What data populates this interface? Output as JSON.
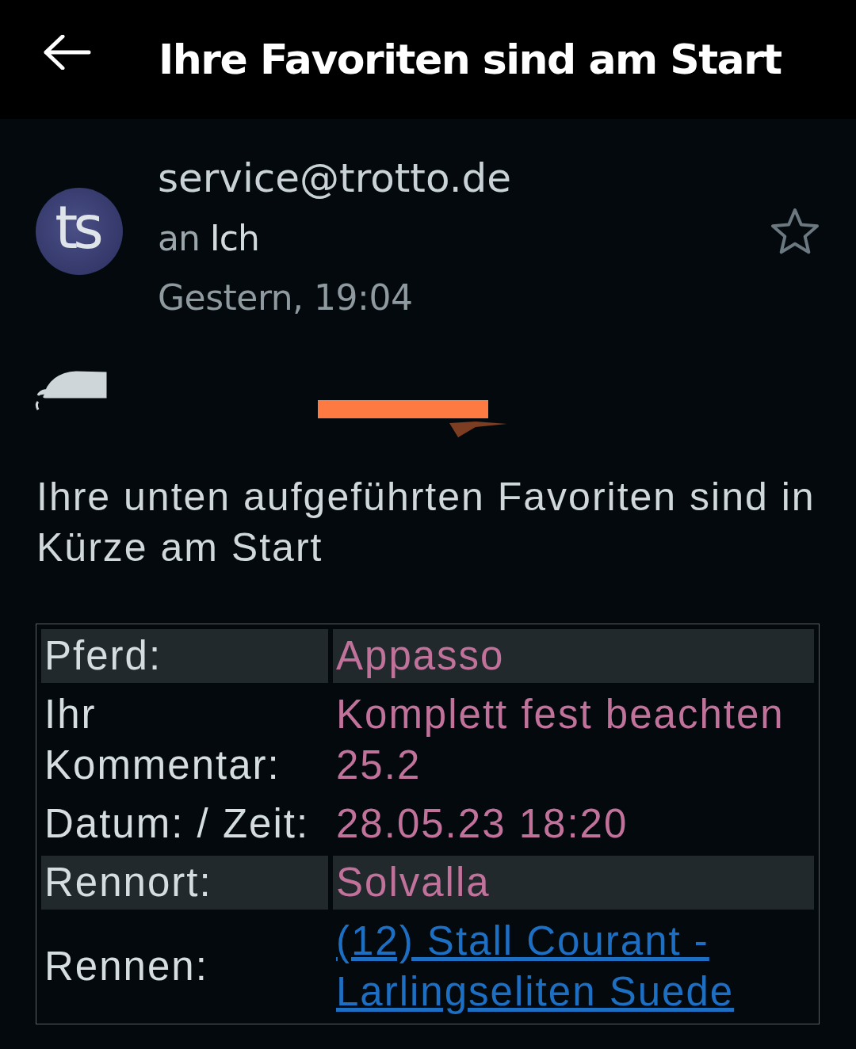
{
  "header": {
    "title": "Ihre Favoriten sind am Start"
  },
  "message": {
    "avatar": {
      "initials": "ts"
    },
    "sender": "service@trotto.de",
    "recipient_prefix": "an",
    "recipient": "Ich",
    "date": "Gestern, 19:04",
    "starred": false
  },
  "body_text": "Ihre unten aufgeführten Favoriten sind in Kürze am Start",
  "table": {
    "rows": [
      {
        "label": "Pferd:",
        "value": "Appasso",
        "kind": "text",
        "shaded": true
      },
      {
        "label": "Ihr Kommentar:",
        "value": "Komplett fest beachten 25.2",
        "kind": "text",
        "shaded": false
      },
      {
        "label": "Datum: / Zeit:",
        "value": "28.05.23 18:20",
        "kind": "text",
        "shaded": false
      },
      {
        "label": "Rennort:",
        "value": "Solvalla",
        "kind": "text",
        "shaded": true
      },
      {
        "label": "Rennen:",
        "value": "(12) Stall Courant - Larlingseliten Suede",
        "kind": "link",
        "shaded": false
      }
    ]
  }
}
